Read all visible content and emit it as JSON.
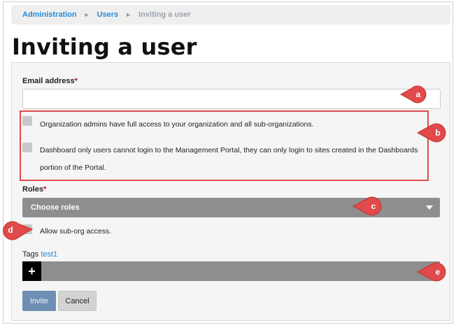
{
  "breadcrumb": {
    "items": [
      "Administration",
      "Users",
      "Inviting a user"
    ],
    "separator": "►"
  },
  "page": {
    "title": "Inviting a user"
  },
  "form": {
    "email": {
      "label": "Email address",
      "required_mark": "*",
      "value": "",
      "placeholder": ""
    },
    "admin_checkbox": {
      "label": "Organization admins have full access to your organization and all sub-organizations.",
      "checked": false
    },
    "dashboard_checkbox": {
      "label_line1": "Dashboard only users cannot login to the Management Portal, they can only login to sites created in the Dashboards",
      "label_line2": "portion of the Portal.",
      "checked": false
    },
    "roles": {
      "label": "Roles",
      "required_mark": "*",
      "selected": "Choose roles"
    },
    "suborg_checkbox": {
      "label": "Allow sub-org access.",
      "checked": false
    },
    "tags": {
      "label": "Tags",
      "tag": "test1",
      "add_label": "+"
    },
    "invite_label": "Invite",
    "cancel_label": "Cancel"
  },
  "callouts": {
    "a": "a",
    "b": "b",
    "c": "c",
    "d": "d",
    "e": "e"
  },
  "colors": {
    "callout": "#e04a4a",
    "link": "#2a8ad4",
    "dropdown": "#8e8e8e",
    "invite": "#6e8fb3"
  }
}
